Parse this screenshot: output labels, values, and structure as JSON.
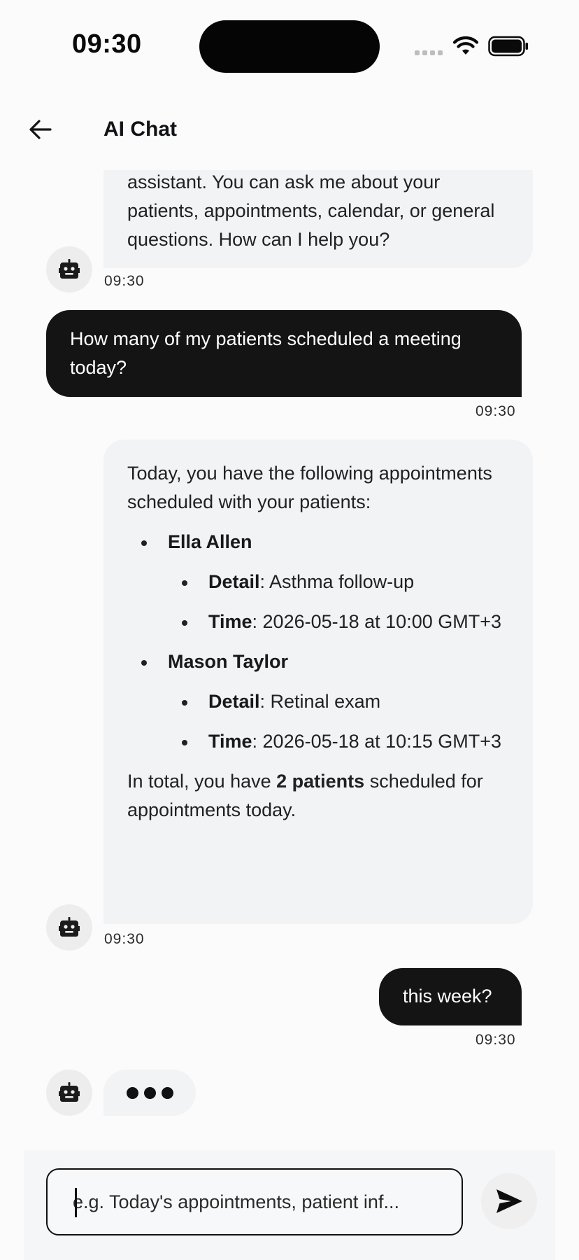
{
  "status_bar": {
    "time": "09:30"
  },
  "header": {
    "back_icon": "arrow-left-icon",
    "title": "AI Chat"
  },
  "messages": [
    {
      "sender": "bot",
      "text": "assistant. You can ask me about your patients, appointments, calendar, or general questions. How can I help you?",
      "time": "09:30"
    },
    {
      "sender": "user",
      "text": "How many of my patients scheduled a meeting today?",
      "time": "09:30"
    },
    {
      "sender": "bot",
      "intro": "Today, you have the following appointments scheduled with your patients:",
      "appointments": [
        {
          "name": "Ella Allen",
          "detail_label": "Detail",
          "detail": ": Asthma follow-up",
          "time_label": "Time",
          "time": ": 2026-05-18 at 10:00 GMT+3"
        },
        {
          "name": "Mason Taylor",
          "detail_label": "Detail",
          "detail": ": Retinal exam",
          "time_label": "Time",
          "time": ": 2026-05-18 at 10:15 GMT+3"
        }
      ],
      "total_prefix": "In total, you have ",
      "total_bold": "2 patients",
      "total_suffix": " scheduled for appointments today.",
      "time": "09:30"
    },
    {
      "sender": "user",
      "text": "this week?",
      "time": "09:30"
    },
    {
      "sender": "bot",
      "typing": true
    }
  ],
  "composer": {
    "placeholder": "e.g. Today's appointments, patient inf...",
    "send_icon": "send-icon"
  },
  "icons": {
    "avatar": "robot-icon"
  }
}
